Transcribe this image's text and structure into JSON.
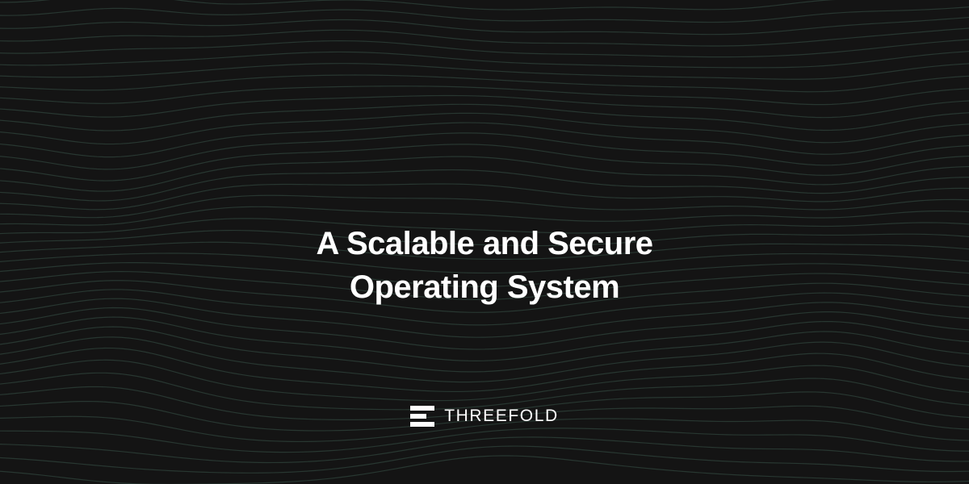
{
  "hero": {
    "title_line1": "A Scalable and Secure",
    "title_line2": "Operating System"
  },
  "brand": {
    "name": "THREEFOLD",
    "logo_icon": "threefold-stacked-bars-logo"
  },
  "colors": {
    "background": "#141414",
    "wave_lines": "#2c3d36",
    "text": "#ffffff"
  }
}
